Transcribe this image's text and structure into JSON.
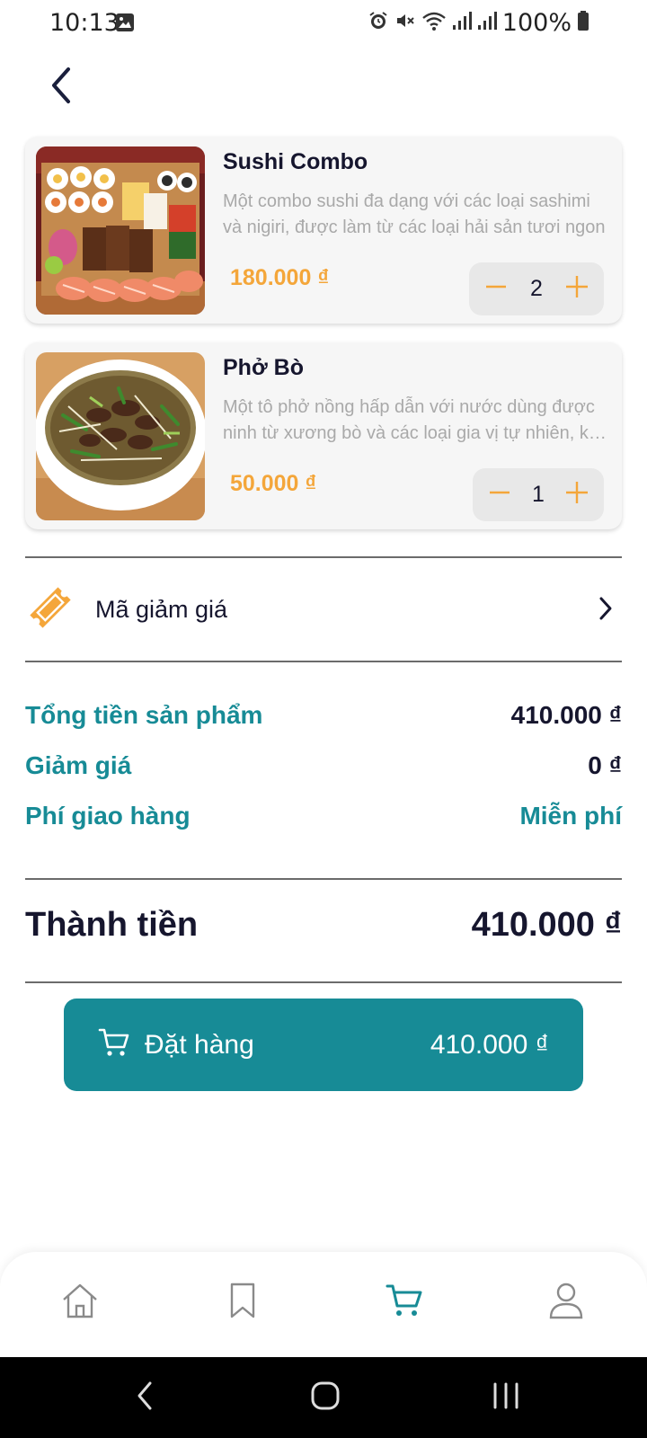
{
  "status_bar": {
    "time": "10:13",
    "battery": "100%"
  },
  "cart": {
    "items": [
      {
        "name": "Sushi Combo",
        "description": "Một combo sushi đa dạng với các loại sashimi và nigiri, được làm từ các loại hải sản tươi ngon",
        "price": "180.000 ₫",
        "quantity": "2"
      },
      {
        "name": "Phở Bò",
        "description": "Một tô phở nồng hấp dẫn với nước dùng được ninh từ xương bò và các loại gia vị tự nhiên, kết hợp",
        "price": "50.000 ₫",
        "quantity": "1"
      }
    ]
  },
  "coupon": {
    "label": "Mã giảm giá"
  },
  "summary": {
    "subtotal_label": "Tổng tiền sản phẩm",
    "subtotal_value": "410.000 ₫",
    "discount_label": "Giảm giá",
    "discount_value": "0 ₫",
    "shipping_label": "Phí giao hàng",
    "shipping_value": "Miễn phí"
  },
  "total": {
    "label": "Thành tiền",
    "value": "410.000 ₫"
  },
  "order_button": {
    "label": "Đặt hàng",
    "total": "410.000 ₫"
  },
  "bottom_nav": {
    "items": [
      {
        "icon": "home-icon",
        "active": false
      },
      {
        "icon": "bookmark-icon",
        "active": false
      },
      {
        "icon": "cart-icon",
        "active": true
      },
      {
        "icon": "profile-icon",
        "active": false
      }
    ]
  },
  "colors": {
    "accent": "#178b96",
    "price": "#f4a63a",
    "text": "#16162e"
  }
}
